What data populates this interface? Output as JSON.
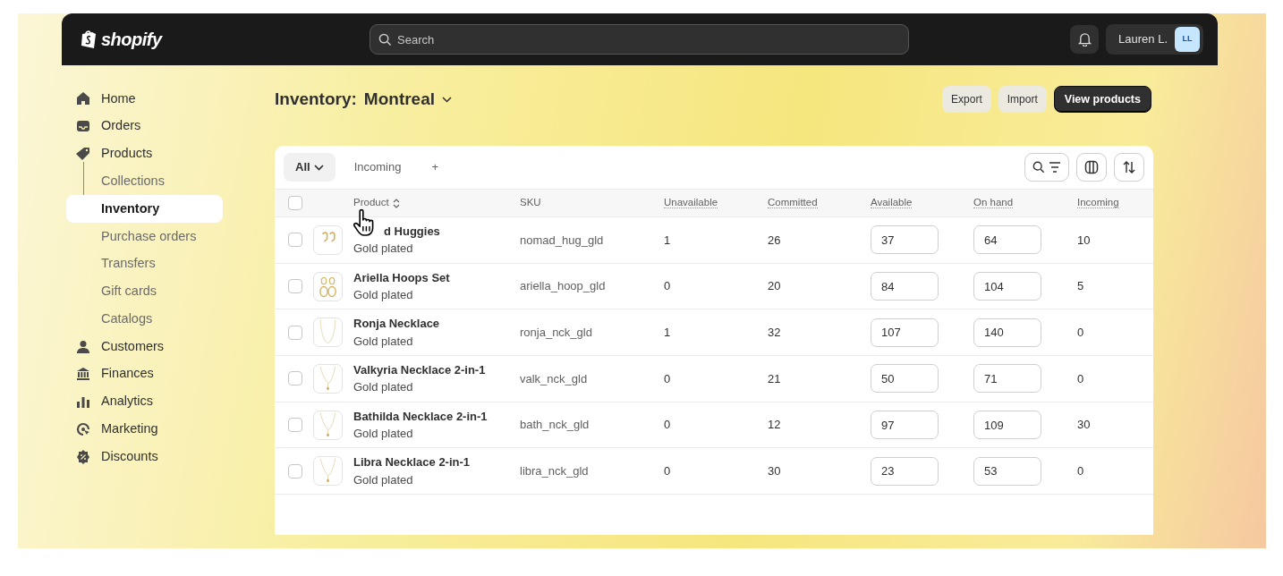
{
  "topbar": {
    "logo": "shopify",
    "search": {
      "placeholder": "Search"
    },
    "user": {
      "name": "Lauren L.",
      "initials": "LL"
    }
  },
  "sidebar": {
    "items": [
      {
        "label": "Home",
        "selected": false
      },
      {
        "label": "Orders",
        "selected": false
      },
      {
        "label": "Products",
        "selected": false,
        "children": [
          {
            "label": "Collections",
            "selected": false
          },
          {
            "label": "Inventory",
            "selected": true
          },
          {
            "label": "Purchase orders",
            "selected": false
          },
          {
            "label": "Transfers",
            "selected": false
          },
          {
            "label": "Gift cards",
            "selected": false
          },
          {
            "label": "Catalogs",
            "selected": false
          }
        ]
      },
      {
        "label": "Customers",
        "selected": false
      },
      {
        "label": "Finances",
        "selected": false
      },
      {
        "label": "Analytics",
        "selected": false
      },
      {
        "label": "Marketing",
        "selected": false
      },
      {
        "label": "Discounts",
        "selected": false
      }
    ]
  },
  "page": {
    "title": "Inventory:",
    "location": "Montreal",
    "buttons": [
      {
        "label": "Export",
        "kind": "secondary"
      },
      {
        "label": "Import",
        "kind": "secondary"
      },
      {
        "label": "View products",
        "kind": "primary"
      }
    ]
  },
  "tabs": [
    {
      "label": "All",
      "selected": true
    },
    {
      "label": "Incoming",
      "selected": false
    },
    {
      "label": "+",
      "selected": false
    }
  ],
  "table": {
    "columns": [
      "Product",
      "SKU",
      "Unavailable",
      "Committed",
      "Available",
      "On hand",
      "Incoming"
    ],
    "all_selected": false,
    "rows": [
      {
        "selected": false,
        "name": "d Huggies",
        "variant": "Gold plated",
        "sku": "nomad_hug_gld",
        "unavailable": "1",
        "committed": "26",
        "available": "37",
        "on_hand": "64",
        "incoming": "10"
      },
      {
        "selected": false,
        "name": "Ariella Hoops Set",
        "variant": "Gold plated",
        "sku": "ariella_hoop_gld",
        "unavailable": "0",
        "committed": "20",
        "available": "84",
        "on_hand": "104",
        "incoming": "5"
      },
      {
        "selected": false,
        "name": "Ronja Necklace",
        "variant": "Gold plated",
        "sku": "ronja_nck_gld",
        "unavailable": "1",
        "committed": "32",
        "available": "107",
        "on_hand": "140",
        "incoming": "0"
      },
      {
        "selected": false,
        "name": "Valkyria Necklace 2-in-1",
        "variant": "Gold plated",
        "sku": "valk_nck_gld",
        "unavailable": "0",
        "committed": "21",
        "available": "50",
        "on_hand": "71",
        "incoming": "0"
      },
      {
        "selected": false,
        "name": "Bathilda Necklace 2-in-1",
        "variant": "Gold plated",
        "sku": "bath_nck_gld",
        "unavailable": "0",
        "committed": "12",
        "available": "97",
        "on_hand": "109",
        "incoming": "30"
      },
      {
        "selected": false,
        "name": "Libra Necklace 2-in-1",
        "variant": "Gold plated",
        "sku": "libra_nck_gld",
        "unavailable": "0",
        "committed": "30",
        "available": "23",
        "on_hand": "53",
        "incoming": "0"
      }
    ]
  }
}
